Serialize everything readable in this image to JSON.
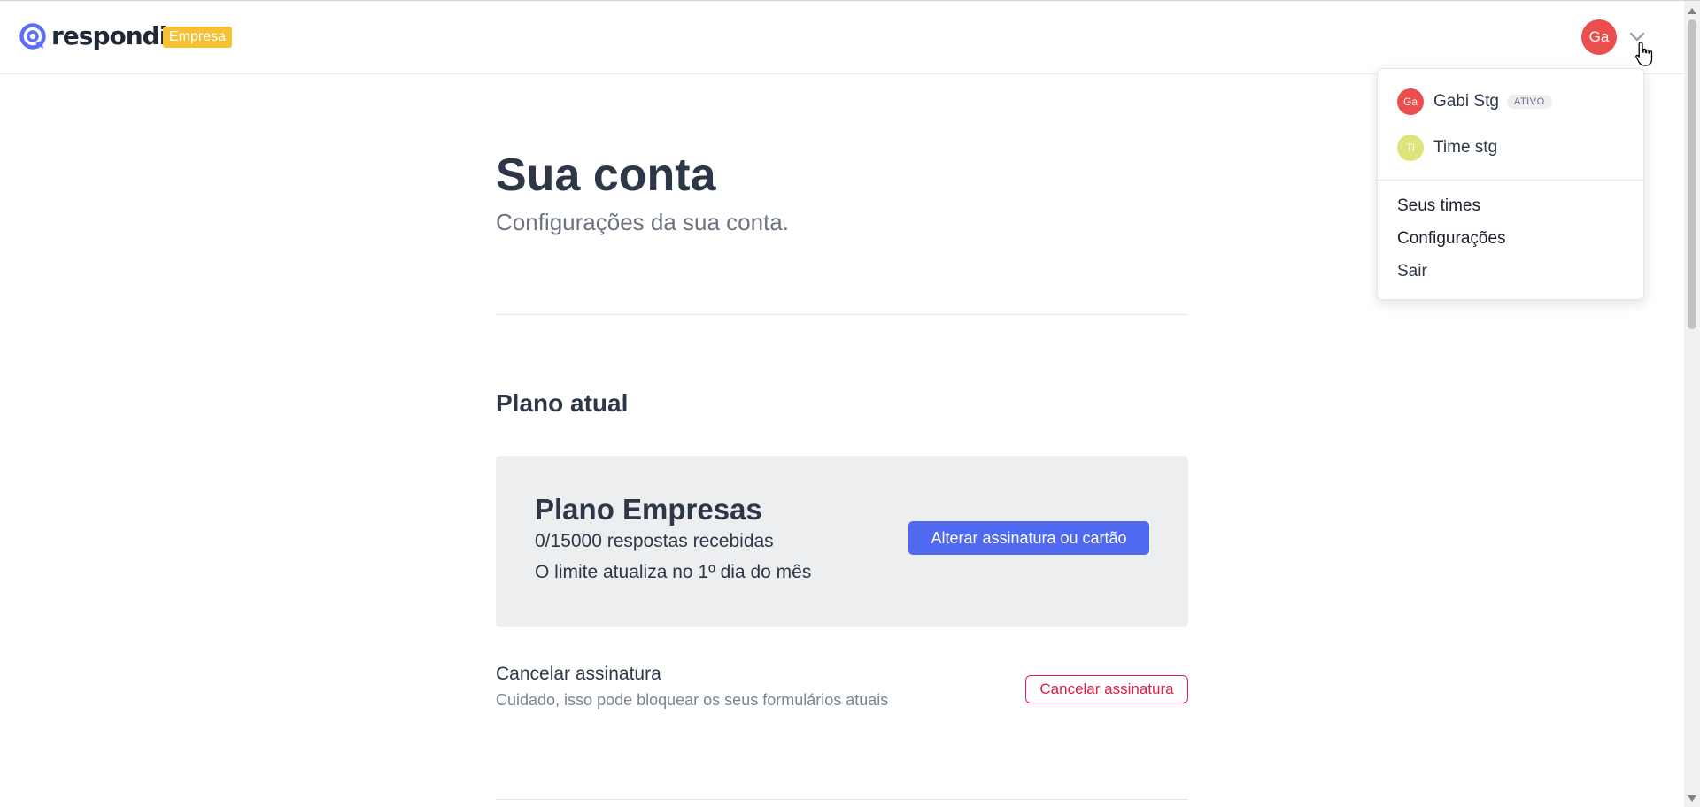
{
  "header": {
    "brand": "respondi",
    "plan_badge": "Empresa",
    "avatar_initials": "Ga"
  },
  "dropdown": {
    "teams": [
      {
        "initials": "Ga",
        "name": "Gabi Stg",
        "status": "ATIVO",
        "color": "#ec4d4d"
      },
      {
        "initials": "Ti",
        "name": "Time stg",
        "status": "",
        "color": "#dde47a"
      }
    ],
    "links": [
      "Seus times",
      "Configurações",
      "Sair"
    ]
  },
  "page": {
    "title": "Sua conta",
    "subtitle": "Configurações da sua conta."
  },
  "plan": {
    "section_title": "Plano atual",
    "name": "Plano Empresas",
    "responses": "0/15000 respostas recebidas",
    "limit_note": "O limite atualiza no 1º dia do mês",
    "change_button": "Alterar assinatura ou cartão"
  },
  "cancel": {
    "title": "Cancelar assinatura",
    "description": "Cuidado, isso pode bloquear os seus formulários atuais",
    "button": "Cancelar assinatura"
  },
  "colors": {
    "accent": "#4f6af0",
    "danger": "#e11d48",
    "badge": "#f6c134"
  }
}
